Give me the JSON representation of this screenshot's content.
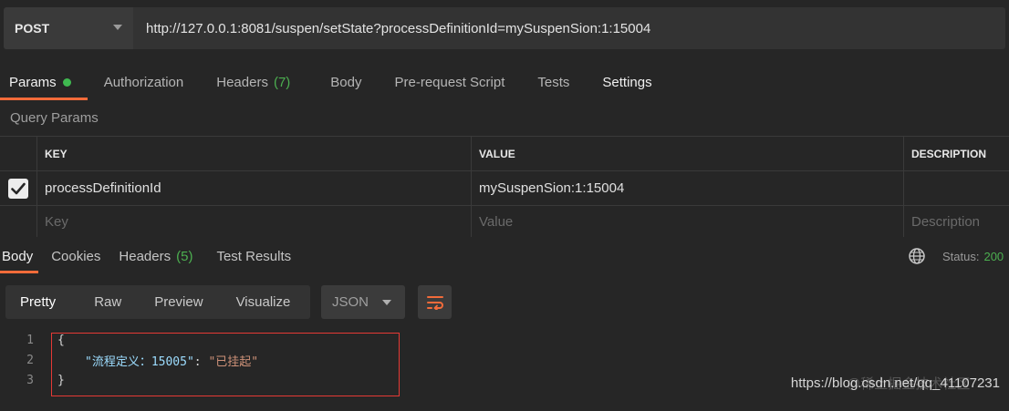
{
  "request": {
    "method": "POST",
    "url": "http://127.0.0.1:8081/suspen/setState?processDefinitionId=mySuspenSion:1:15004"
  },
  "request_tabs": [
    {
      "label": "Params",
      "count": ""
    },
    {
      "label": "Authorization",
      "count": ""
    },
    {
      "label": "Headers",
      "count": "(7)"
    },
    {
      "label": "Body",
      "count": ""
    },
    {
      "label": "Pre-request Script",
      "count": ""
    },
    {
      "label": "Tests",
      "count": ""
    },
    {
      "label": "Settings",
      "count": ""
    }
  ],
  "query_params_title": "Query Params",
  "params_table": {
    "headers": {
      "key": "KEY",
      "value": "VALUE",
      "description": "DESCRIPTION"
    },
    "rows": [
      {
        "key": "processDefinitionId",
        "value": "mySuspenSion:1:15004",
        "description": ""
      }
    ],
    "placeholders": {
      "key": "Key",
      "value": "Value",
      "description": "Description"
    }
  },
  "response_tabs": [
    {
      "label": "Body",
      "count": ""
    },
    {
      "label": "Cookies",
      "count": ""
    },
    {
      "label": "Headers",
      "count": "(5)"
    },
    {
      "label": "Test Results",
      "count": ""
    }
  ],
  "status": {
    "label": "Status:",
    "value": "200"
  },
  "view_modes": [
    "Pretty",
    "Raw",
    "Preview",
    "Visualize"
  ],
  "format": "JSON",
  "code_lines": [
    {
      "num": "1",
      "text": "{"
    },
    {
      "num": "2",
      "key": "\"流程定义：15005\"",
      "sep": ": ",
      "value": "\"已挂起\""
    },
    {
      "num": "3",
      "text": "}"
    }
  ],
  "watermark": "https://blog.csdn.net/qq_41107231",
  "watermark2": "@稀土掘金技术社区",
  "colors": {
    "accent": "#f26b3a",
    "green": "#4caf50",
    "highlight": "#e53935"
  }
}
